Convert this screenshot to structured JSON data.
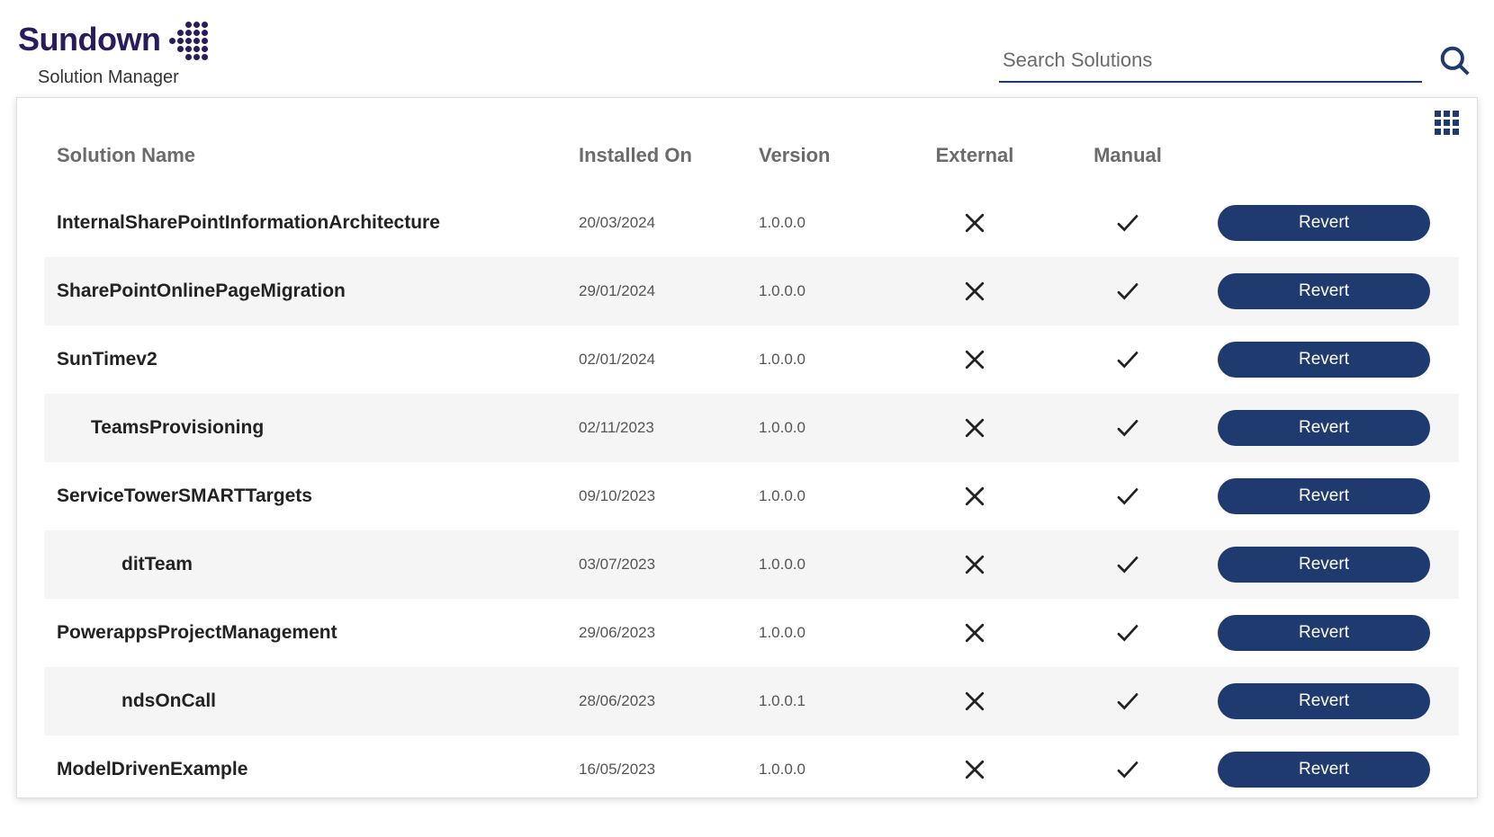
{
  "header": {
    "logo_text": "Sundown",
    "subtitle": "Solution Manager"
  },
  "search": {
    "placeholder": "Search Solutions"
  },
  "table": {
    "headers": {
      "name": "Solution Name",
      "installed": "Installed On",
      "version": "Version",
      "external": "External",
      "manual": "Manual"
    },
    "button_label": "Revert",
    "rows": [
      {
        "name": "InternalSharePointInformationArchitecture",
        "installed": "20/03/2024",
        "version": "1.0.0.0",
        "external": false,
        "manual": true,
        "alt": false,
        "indent": 0
      },
      {
        "name": "SharePointOnlinePageMigration",
        "installed": "29/01/2024",
        "version": "1.0.0.0",
        "external": false,
        "manual": true,
        "alt": true,
        "indent": 0
      },
      {
        "name": "SunTimev2",
        "installed": "02/01/2024",
        "version": "1.0.0.0",
        "external": false,
        "manual": true,
        "alt": false,
        "indent": 0
      },
      {
        "name": "TeamsProvisioning",
        "installed": "02/11/2023",
        "version": "1.0.0.0",
        "external": false,
        "manual": true,
        "alt": true,
        "indent": 1
      },
      {
        "name": "ServiceTowerSMARTTargets",
        "installed": "09/10/2023",
        "version": "1.0.0.0",
        "external": false,
        "manual": true,
        "alt": false,
        "indent": 0
      },
      {
        "name": "ditTeam",
        "installed": "03/07/2023",
        "version": "1.0.0.0",
        "external": false,
        "manual": true,
        "alt": true,
        "indent": 2
      },
      {
        "name": "PowerappsProjectManagement",
        "installed": "29/06/2023",
        "version": "1.0.0.0",
        "external": false,
        "manual": true,
        "alt": false,
        "indent": 0
      },
      {
        "name": "ndsOnCall",
        "installed": "28/06/2023",
        "version": "1.0.0.1",
        "external": false,
        "manual": true,
        "alt": true,
        "indent": 2
      },
      {
        "name": "ModelDrivenExample",
        "installed": "16/05/2023",
        "version": "1.0.0.0",
        "external": false,
        "manual": true,
        "alt": false,
        "indent": 0
      }
    ]
  }
}
